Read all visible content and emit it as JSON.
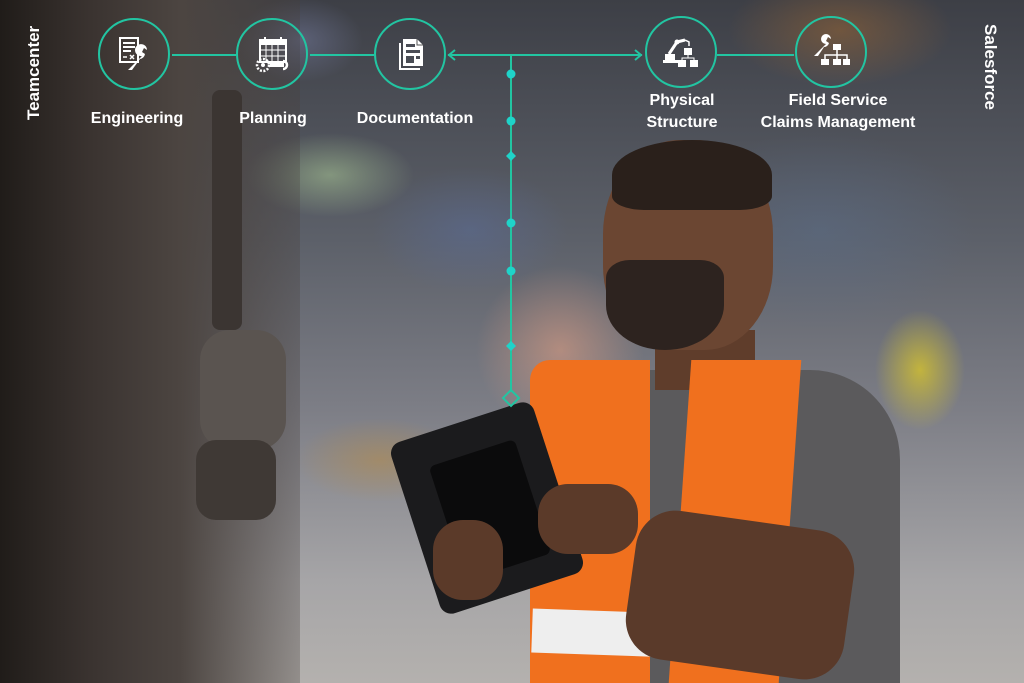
{
  "side_labels": {
    "left": "Teamcenter",
    "right": "Salesforce"
  },
  "nodes": [
    {
      "id": "engineering",
      "label": "Engineering",
      "icon": "document-wrench-icon"
    },
    {
      "id": "planning",
      "label": "Planning",
      "icon": "calendar-gear-wrench-icon"
    },
    {
      "id": "documentation",
      "label": "Documentation",
      "icon": "documents-icon"
    },
    {
      "id": "physical-structure",
      "label_line1": "Physical",
      "label_line2": "Structure",
      "icon": "robot-arm-boxes-icon"
    },
    {
      "id": "field-service",
      "label_line1": "Field Service",
      "label_line2": "Claims Management",
      "icon": "wrench-hierarchy-icon"
    }
  ],
  "connector": {
    "color": "#22c5a2",
    "marker_color": "#1fd3c9",
    "arrows": [
      "into-documentation",
      "into-physical-structure"
    ],
    "vertical_markers": [
      "dot",
      "dot",
      "diamond",
      "dot",
      "dot",
      "diamond",
      "hollow-diamond"
    ]
  }
}
